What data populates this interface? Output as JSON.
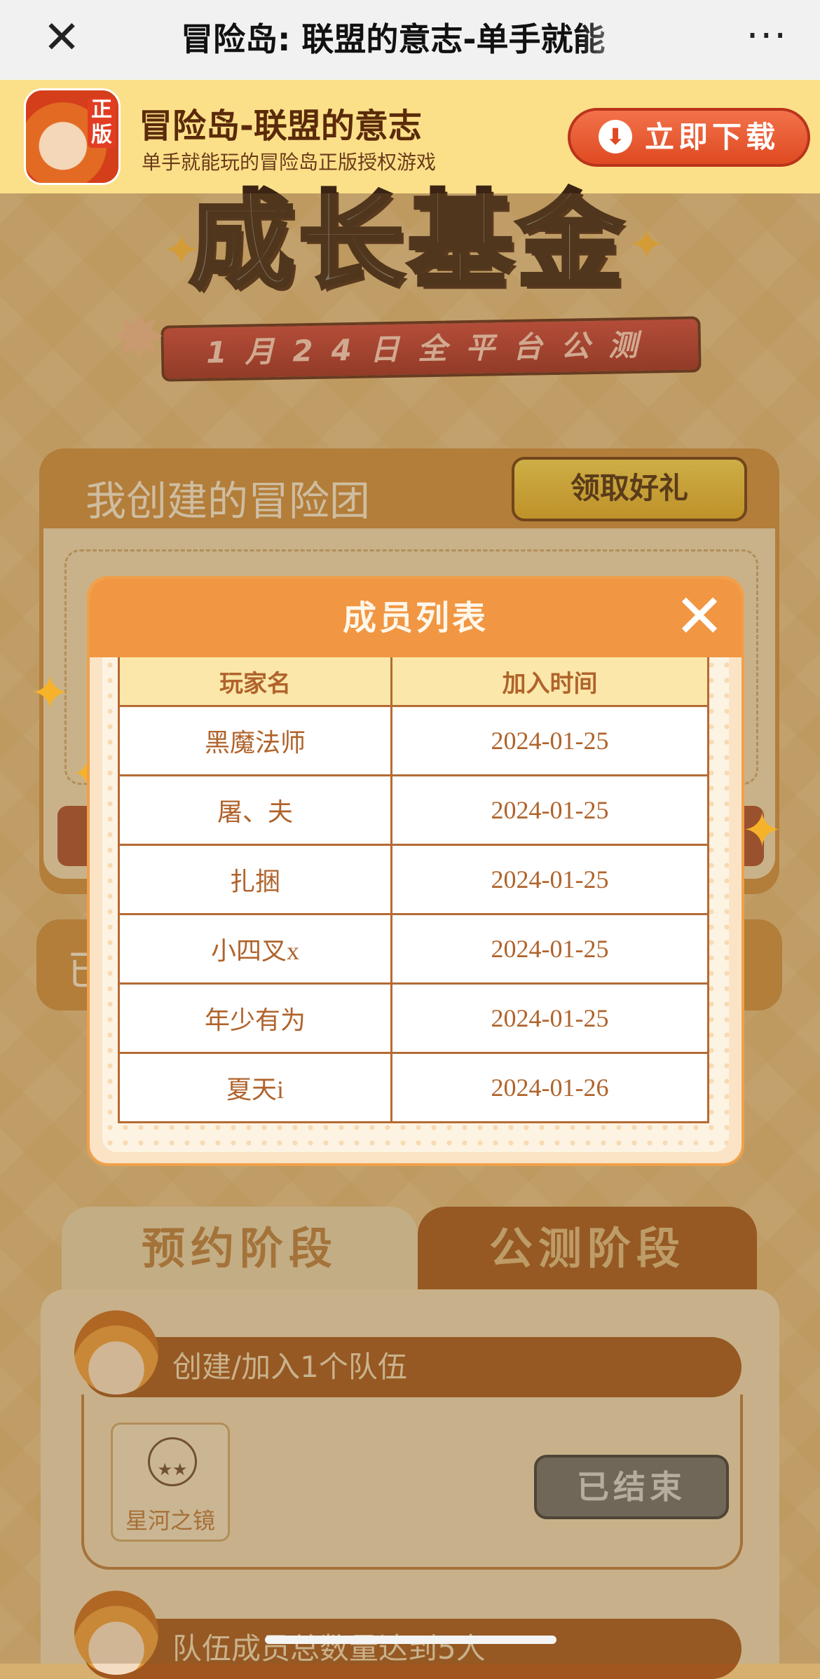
{
  "browser": {
    "title": "冒险岛: 联盟的意志-单手就能",
    "close_icon": "close-icon",
    "more_icon": "more-icon"
  },
  "banner": {
    "app_name": "冒险岛-联盟的意志",
    "app_desc": "单手就能玩的冒险岛正版授权游戏",
    "icon_tag": "正版",
    "download_label": "立即下载"
  },
  "hero": {
    "title": "成长基金",
    "subtitle": "1月24日全平台公测"
  },
  "team_card": {
    "heading": "我创建的冒险团",
    "gift_button": "领取好礼",
    "other_label": "已"
  },
  "modal": {
    "title": "成员列表",
    "columns": [
      "玩家名",
      "加入时间"
    ],
    "rows": [
      {
        "name": "黑魔法师",
        "date": "2024-01-25"
      },
      {
        "name": "屠、夫",
        "date": "2024-01-25"
      },
      {
        "name": "扎捆",
        "date": "2024-01-25"
      },
      {
        "name": "小四叉x",
        "date": "2024-01-25"
      },
      {
        "name": "年少有为",
        "date": "2024-01-25"
      },
      {
        "name": "夏天i",
        "date": "2024-01-26"
      }
    ]
  },
  "tabs": {
    "reserve": "预约阶段",
    "public": "公测阶段"
  },
  "tasks": [
    {
      "label": "创建/加入1个队伍",
      "reward_name": "星河之镜",
      "status": "已结束"
    },
    {
      "label": "队伍成员总数量达到5人"
    }
  ],
  "colors": {
    "banner_bg": "#fbe089",
    "modal_header": "#f19642",
    "table_header": "#fbe7aa",
    "table_text": "#b0632b"
  }
}
